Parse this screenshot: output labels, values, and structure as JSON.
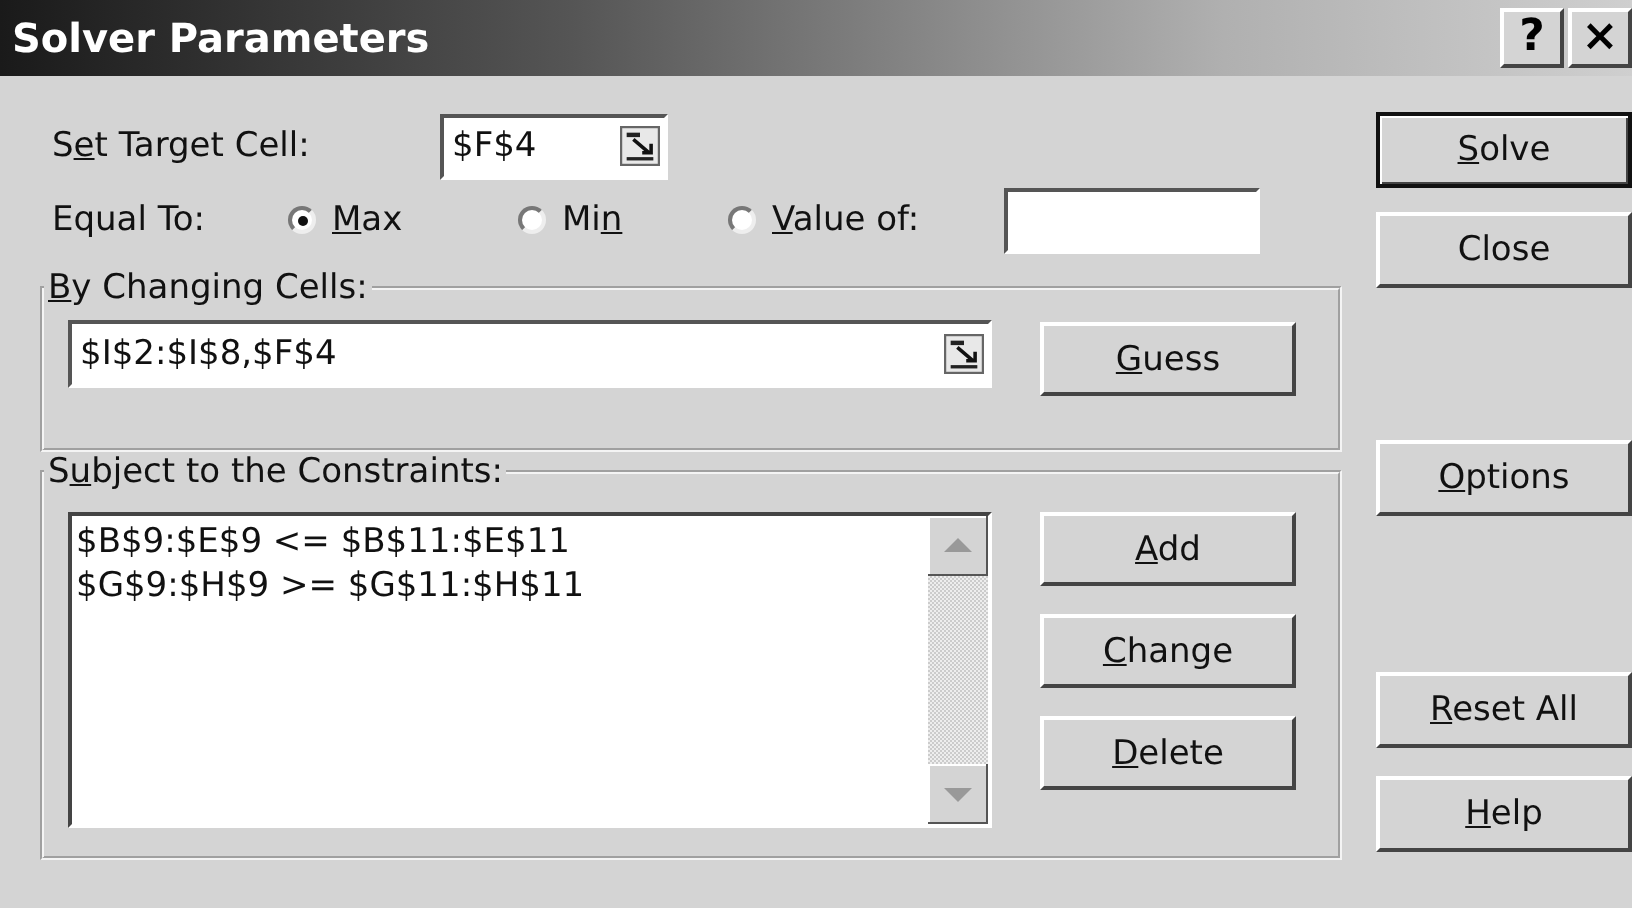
{
  "window": {
    "title": "Solver Parameters",
    "title_buttons": [
      "?",
      "×"
    ]
  },
  "target": {
    "label": {
      "pre": "S",
      "key": "e",
      "post": "t Target Cell:"
    },
    "value": "$F$4"
  },
  "equal_to": {
    "label": "Equal To:",
    "options": [
      {
        "label": {
          "key": "M",
          "post": "ax"
        },
        "selected": true
      },
      {
        "label": {
          "pre": "Mi",
          "key": "n"
        },
        "selected": false
      },
      {
        "label": {
          "key": "V",
          "post": "alue of:"
        },
        "selected": false
      }
    ]
  },
  "changing_cells": {
    "title": {
      "key": "B",
      "post": "y Changing Cells:"
    },
    "value": "$I$2:$I$8,$F$4",
    "button": {
      "key": "G",
      "post": "uess"
    }
  },
  "constraints": {
    "title": {
      "pre": "S",
      "key": "u",
      "post": "bject to the Constraints:"
    },
    "items": [
      "$B$9:$E$9 <= $B$11:$E$11",
      "$G$9:$H$9 >= $G$11:$H$11"
    ],
    "buttons": [
      {
        "key": "A",
        "post": "dd"
      },
      {
        "key": "C",
        "post": "hange"
      },
      {
        "key": "D",
        "post": "elete"
      }
    ]
  },
  "side_buttons": [
    {
      "label": {
        "key": "S",
        "post": "olve"
      },
      "default": true
    },
    {
      "label": {
        "post": "Close"
      },
      "default": false
    },
    {
      "label": {
        "key": "O",
        "post": "ptions"
      },
      "default": false
    },
    {
      "label": {
        "key": "R",
        "post": "eset All"
      },
      "default": false
    },
    {
      "label": {
        "key": "H",
        "post": "elp"
      },
      "default": false
    }
  ]
}
